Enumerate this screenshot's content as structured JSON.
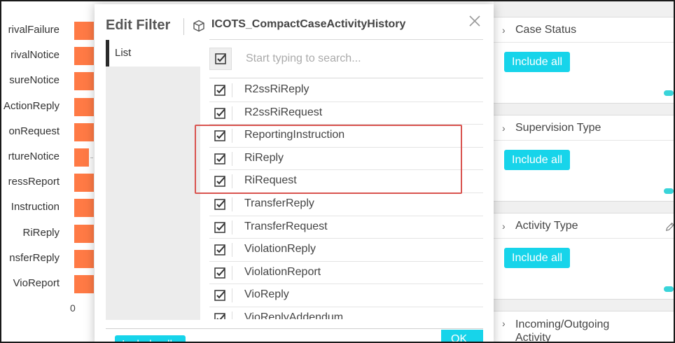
{
  "chart": {
    "categories": [
      {
        "label": "rivalFailure",
        "value": 1.0
      },
      {
        "label": "rivalNotice",
        "value": 1.0
      },
      {
        "label": "sureNotice",
        "value": 1.0
      },
      {
        "label": "ActionReply",
        "value": 1.0
      },
      {
        "label": "onRequest",
        "value": 1.0
      },
      {
        "label": "rtureNotice",
        "value": 0.76
      },
      {
        "label": "ressReport",
        "value": 1.0
      },
      {
        "label": "Instruction",
        "value": 1.0
      },
      {
        "label": "RiReply",
        "value": 1.0
      },
      {
        "label": "nsferReply",
        "value": 1.0
      },
      {
        "label": "VioReport",
        "value": 1.0
      }
    ],
    "axis_zero": "0",
    "bar_color": "#ff7a45"
  },
  "modal": {
    "title": "Edit Filter",
    "dataset_name": "ICOTS_CompactCaseActivityHistory",
    "left_tab": "List",
    "search_placeholder": "Start typing to search...",
    "items": [
      {
        "label": "R2ssRiReply",
        "checked": true
      },
      {
        "label": "R2ssRiRequest",
        "checked": true
      },
      {
        "label": "ReportingInstruction",
        "checked": true
      },
      {
        "label": "RiReply",
        "checked": true
      },
      {
        "label": "RiRequest",
        "checked": true
      },
      {
        "label": "TransferReply",
        "checked": true
      },
      {
        "label": "TransferRequest",
        "checked": true
      },
      {
        "label": "ViolationReply",
        "checked": true
      },
      {
        "label": "ViolationReport",
        "checked": true
      },
      {
        "label": "VioReply",
        "checked": true
      },
      {
        "label": "VioReplyAddendum",
        "checked": true
      }
    ],
    "footer_include_label": "Include all",
    "ok_label": "OK",
    "highlight_color": "#d9534f"
  },
  "right_panel": {
    "sections": [
      {
        "title": "Case Status",
        "button": "Include all"
      },
      {
        "title": "Supervision Type",
        "button": "Include all"
      },
      {
        "title": "Activity Type",
        "button": "Include all"
      },
      {
        "title": "Incoming/Outgoing Activity"
      }
    ],
    "accent_color": "#17d4ea"
  }
}
